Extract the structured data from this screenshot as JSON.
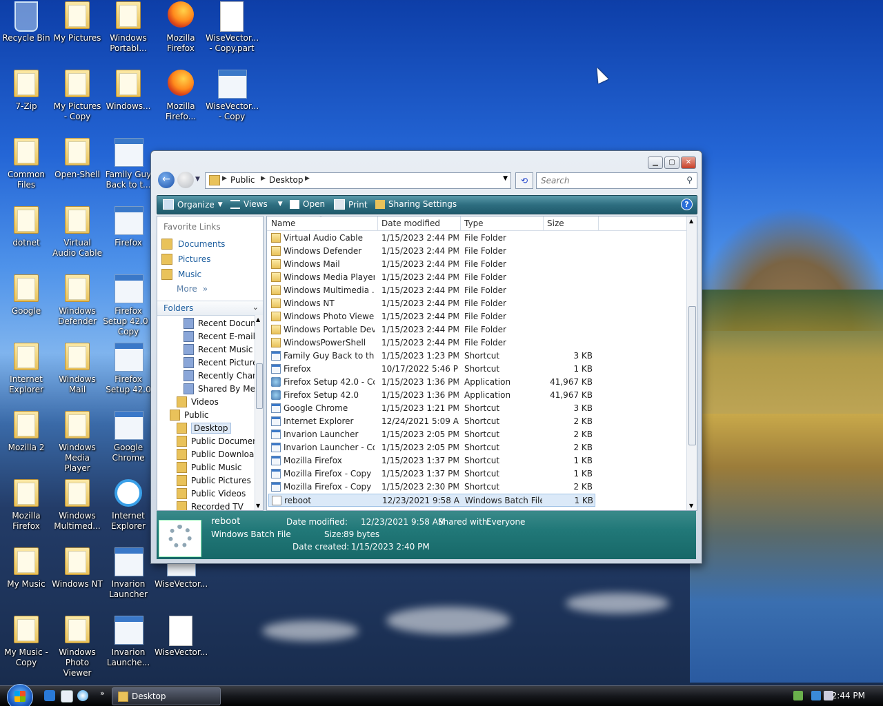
{
  "desktop": {
    "icons": [
      {
        "label": "Recycle Bin",
        "icon": "recycle-bin-icon"
      },
      {
        "label": "My Pictures",
        "icon": "folder-icon"
      },
      {
        "label": "Windows Portabl...",
        "icon": "folder-icon"
      },
      {
        "label": "Mozilla Firefox",
        "icon": "firefox-icon"
      },
      {
        "label": "WiseVector... - Copy.part",
        "icon": "document-icon"
      },
      {
        "label": "7-Zip",
        "icon": "folder-icon"
      },
      {
        "label": "My Pictures - Copy",
        "icon": "folder-icon"
      },
      {
        "label": "Windows...",
        "icon": "folder-icon"
      },
      {
        "label": "Mozilla Firefo...",
        "icon": "firefox-icon"
      },
      {
        "label": "WiseVector... - Copy",
        "icon": "installer-icon"
      },
      {
        "label": "Common Files",
        "icon": "folder-icon"
      },
      {
        "label": "Open-Shell",
        "icon": "folder-icon"
      },
      {
        "label": "Family Guy Back to t...",
        "icon": "shortcut-icon"
      },
      {
        "label": "dotnet",
        "icon": "folder-icon"
      },
      {
        "label": "Virtual Audio Cable",
        "icon": "folder-icon"
      },
      {
        "label": "Firefox",
        "icon": "shortcut-icon"
      },
      {
        "label": "Google",
        "icon": "folder-icon"
      },
      {
        "label": "Windows Defender",
        "icon": "folder-icon"
      },
      {
        "label": "Firefox Setup 42.0 - Copy",
        "icon": "installer-icon"
      },
      {
        "label": "Internet Explorer",
        "icon": "folder-icon"
      },
      {
        "label": "Windows Mail",
        "icon": "folder-icon"
      },
      {
        "label": "Firefox Setup 42.0",
        "icon": "installer-icon"
      },
      {
        "label": "Mozilla 2",
        "icon": "folder-icon"
      },
      {
        "label": "Windows Media Player",
        "icon": "folder-icon"
      },
      {
        "label": "Google Chrome",
        "icon": "shortcut-icon"
      },
      {
        "label": "Mozilla Firefox",
        "icon": "folder-icon"
      },
      {
        "label": "Windows Multimed...",
        "icon": "folder-icon"
      },
      {
        "label": "Internet Explorer",
        "icon": "internet-explorer-icon"
      },
      {
        "label": "My Music",
        "icon": "folder-icon"
      },
      {
        "label": "Windows NT",
        "icon": "folder-icon"
      },
      {
        "label": "Invarion Launcher",
        "icon": "shortcut-icon"
      },
      {
        "label": "WiseVector...",
        "icon": "installer-icon"
      },
      {
        "label": "My Music - Copy",
        "icon": "folder-icon"
      },
      {
        "label": "Windows Photo Viewer",
        "icon": "folder-icon"
      },
      {
        "label": "Invarion Launche...",
        "icon": "shortcut-icon"
      },
      {
        "label": "WiseVector...",
        "icon": "document-icon"
      }
    ]
  },
  "window": {
    "breadcrumb": [
      "Public",
      "Desktop"
    ],
    "search_placeholder": "Search",
    "toolbar": {
      "organize": "Organize",
      "views": "Views",
      "open": "Open",
      "print": "Print",
      "sharing": "Sharing Settings"
    },
    "nav": {
      "favorites_header": "Favorite Links",
      "favorites": [
        "Documents",
        "Pictures",
        "Music"
      ],
      "more": "More",
      "folders_header": "Folders",
      "tree": [
        {
          "label": "Recent Docum",
          "indent": 2
        },
        {
          "label": "Recent E-mail",
          "indent": 2
        },
        {
          "label": "Recent Music",
          "indent": 2
        },
        {
          "label": "Recent Picture",
          "indent": 2
        },
        {
          "label": "Recently Chan",
          "indent": 2
        },
        {
          "label": "Shared By Me",
          "indent": 2
        },
        {
          "label": "Videos",
          "indent": 1
        },
        {
          "label": "Public",
          "indent": 0
        },
        {
          "label": "Desktop",
          "indent": 1,
          "selected": true
        },
        {
          "label": "Public Documen",
          "indent": 1
        },
        {
          "label": "Public Downloac",
          "indent": 1
        },
        {
          "label": "Public Music",
          "indent": 1
        },
        {
          "label": "Public Pictures",
          "indent": 1
        },
        {
          "label": "Public Videos",
          "indent": 1
        },
        {
          "label": "Recorded TV",
          "indent": 1
        }
      ]
    },
    "columns": [
      "Name",
      "Date modified",
      "Type",
      "Size"
    ],
    "files": [
      {
        "name": "Virtual Audio Cable",
        "date": "1/15/2023 2:44 PM",
        "type": "File Folder",
        "size": "",
        "kind": "folder"
      },
      {
        "name": "Windows Defender",
        "date": "1/15/2023 2:44 PM",
        "type": "File Folder",
        "size": "",
        "kind": "folder"
      },
      {
        "name": "Windows Mail",
        "date": "1/15/2023 2:44 PM",
        "type": "File Folder",
        "size": "",
        "kind": "folder"
      },
      {
        "name": "Windows Media Player",
        "date": "1/15/2023 2:44 PM",
        "type": "File Folder",
        "size": "",
        "kind": "folder"
      },
      {
        "name": "Windows Multimedia ...",
        "date": "1/15/2023 2:44 PM",
        "type": "File Folder",
        "size": "",
        "kind": "folder"
      },
      {
        "name": "Windows NT",
        "date": "1/15/2023 2:44 PM",
        "type": "File Folder",
        "size": "",
        "kind": "folder"
      },
      {
        "name": "Windows Photo Viewer",
        "date": "1/15/2023 2:44 PM",
        "type": "File Folder",
        "size": "",
        "kind": "folder"
      },
      {
        "name": "Windows Portable Dev...",
        "date": "1/15/2023 2:44 PM",
        "type": "File Folder",
        "size": "",
        "kind": "folder"
      },
      {
        "name": "WindowsPowerShell",
        "date": "1/15/2023 2:44 PM",
        "type": "File Folder",
        "size": "",
        "kind": "folder"
      },
      {
        "name": "Family Guy Back to the...",
        "date": "1/15/2023 1:23 PM",
        "type": "Shortcut",
        "size": "3 KB",
        "kind": "shortcut"
      },
      {
        "name": "Firefox",
        "date": "10/17/2022 5:46 PM",
        "type": "Shortcut",
        "size": "1 KB",
        "kind": "shortcut"
      },
      {
        "name": "Firefox Setup 42.0 - Co...",
        "date": "1/15/2023 1:36 PM",
        "type": "Application",
        "size": "41,967 KB",
        "kind": "app"
      },
      {
        "name": "Firefox Setup 42.0",
        "date": "1/15/2023 1:36 PM",
        "type": "Application",
        "size": "41,967 KB",
        "kind": "app"
      },
      {
        "name": "Google Chrome",
        "date": "1/15/2023 1:21 PM",
        "type": "Shortcut",
        "size": "3 KB",
        "kind": "shortcut"
      },
      {
        "name": "Internet Explorer",
        "date": "12/24/2021 5:09 AM",
        "type": "Shortcut",
        "size": "2 KB",
        "kind": "shortcut"
      },
      {
        "name": "Invarion Launcher",
        "date": "1/15/2023 2:05 PM",
        "type": "Shortcut",
        "size": "2 KB",
        "kind": "shortcut"
      },
      {
        "name": "Invarion Launcher - Co...",
        "date": "1/15/2023 2:05 PM",
        "type": "Shortcut",
        "size": "2 KB",
        "kind": "shortcut"
      },
      {
        "name": "Mozilla Firefox",
        "date": "1/15/2023 1:37 PM",
        "type": "Shortcut",
        "size": "1 KB",
        "kind": "shortcut"
      },
      {
        "name": "Mozilla Firefox - Copy",
        "date": "1/15/2023 1:37 PM",
        "type": "Shortcut",
        "size": "1 KB",
        "kind": "shortcut"
      },
      {
        "name": "Mozilla Firefox - Copy ...",
        "date": "1/15/2023 2:30 PM",
        "type": "Shortcut",
        "size": "2 KB",
        "kind": "shortcut"
      },
      {
        "name": "reboot",
        "date": "12/23/2021 9:58 AM",
        "type": "Windows Batch File",
        "size": "1 KB",
        "kind": "batch",
        "selected": true
      }
    ],
    "details": {
      "name": "reboot",
      "type": "Windows Batch File",
      "date_modified_label": "Date modified:",
      "date_modified": "12/23/2021 9:58 AM",
      "size_label": "Size:",
      "size": "89 bytes",
      "date_created_label": "Date created:",
      "date_created": "1/15/2023 2:40 PM",
      "shared_label": "Shared with:",
      "shared": "Everyone"
    }
  },
  "taskbar": {
    "task_label": "Desktop",
    "clock": "2:44 PM"
  }
}
